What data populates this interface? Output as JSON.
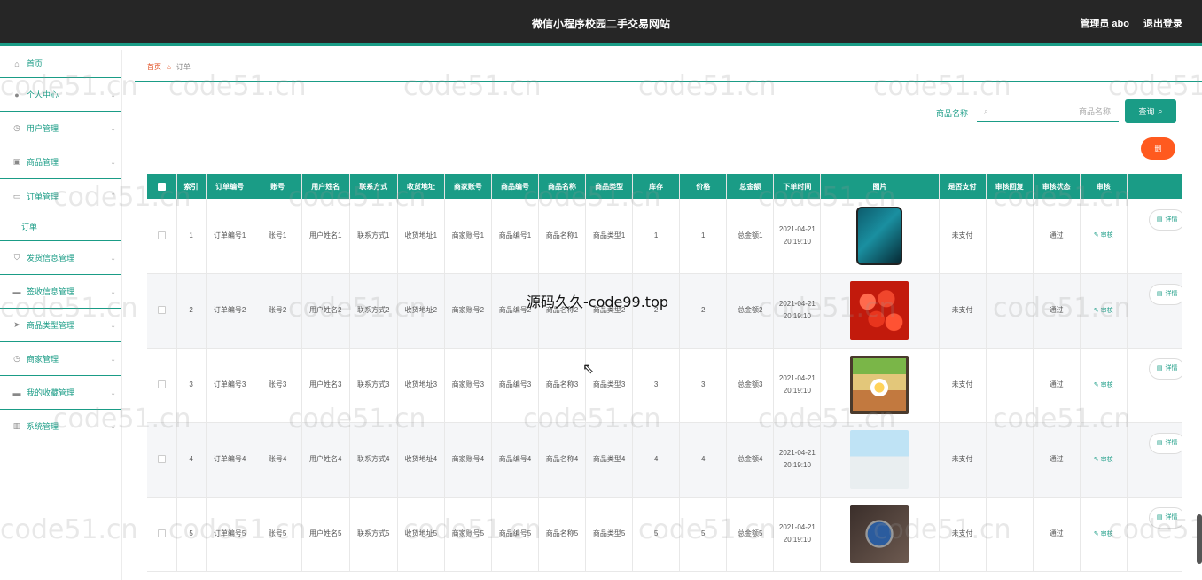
{
  "header": {
    "title": "微信小程序校园二手交易网站",
    "admin_label": "管理员 abo",
    "logout_label": "退出登录"
  },
  "sidebar": {
    "home": "首页",
    "items": [
      {
        "label": "个人中心",
        "icon": "user-icon"
      },
      {
        "label": "用户管理",
        "icon": "clock-icon"
      },
      {
        "label": "商品管理",
        "icon": "bag-icon"
      },
      {
        "label": "订单管理",
        "icon": "message-icon"
      }
    ],
    "sub_item": "订单",
    "items2": [
      {
        "label": "发货信息管理",
        "icon": "shield-icon"
      },
      {
        "label": "签收信息管理",
        "icon": "message-icon"
      },
      {
        "label": "商品类型管理",
        "icon": "send-icon"
      },
      {
        "label": "商家管理",
        "icon": "clock-icon"
      },
      {
        "label": "我的收藏管理",
        "icon": "message-icon"
      },
      {
        "label": "系统管理",
        "icon": "chart-icon"
      }
    ]
  },
  "breadcrumb": {
    "home": "首页",
    "current": "订单"
  },
  "search": {
    "label": "商品名称",
    "placeholder": "商品名称",
    "button": "查询"
  },
  "delete_button": "删",
  "table": {
    "headers": [
      "索引",
      "订单编号",
      "账号",
      "用户姓名",
      "联系方式",
      "收货地址",
      "商家账号",
      "商品编号",
      "商品名称",
      "商品类型",
      "库存",
      "价格",
      "总金额",
      "下单时间",
      "图片",
      "是否支付",
      "审核回复",
      "审核状态",
      "审核"
    ],
    "audit_label": "审核",
    "detail_label": "详情",
    "rows": [
      {
        "idx": "1",
        "order_no": "订单编号1",
        "account": "账号1",
        "name": "用户姓名1",
        "contact": "联系方式1",
        "address": "收货地址1",
        "merchant": "商家账号1",
        "goods_no": "商品编号1",
        "goods_name": "商品名称1",
        "goods_type": "商品类型1",
        "stock": "1",
        "price": "1",
        "total": "总金额1",
        "time": "2021-04-21 20:19:10",
        "image": "phone",
        "paid": "未支付",
        "reply": "",
        "status": "通过"
      },
      {
        "idx": "2",
        "order_no": "订单编号2",
        "account": "账号2",
        "name": "用户姓名2",
        "contact": "联系方式2",
        "address": "收货地址2",
        "merchant": "商家账号2",
        "goods_no": "商品编号2",
        "goods_name": "商品名称2",
        "goods_type": "商品类型2",
        "stock": "2",
        "price": "2",
        "total": "总金额2",
        "time": "2021-04-21 20:19:10",
        "image": "cherries",
        "paid": "未支付",
        "reply": "",
        "status": "通过"
      },
      {
        "idx": "3",
        "order_no": "订单编号3",
        "account": "账号3",
        "name": "用户姓名3",
        "contact": "联系方式3",
        "address": "收货地址3",
        "merchant": "商家账号3",
        "goods_no": "商品编号3",
        "goods_name": "商品名称3",
        "goods_type": "商品类型3",
        "stock": "3",
        "price": "3",
        "total": "总金额3",
        "time": "2021-04-21 20:19:10",
        "image": "lunchbox",
        "paid": "未支付",
        "reply": "",
        "status": "通过"
      },
      {
        "idx": "4",
        "order_no": "订单编号4",
        "account": "账号4",
        "name": "用户姓名4",
        "contact": "联系方式4",
        "address": "收货地址4",
        "merchant": "商家账号4",
        "goods_no": "商品编号4",
        "goods_name": "商品名称4",
        "goods_type": "商品类型4",
        "stock": "4",
        "price": "4",
        "total": "总金额4",
        "time": "2021-04-21 20:19:10",
        "image": "dress",
        "paid": "未支付",
        "reply": "",
        "status": "通过"
      },
      {
        "idx": "5",
        "order_no": "订单编号5",
        "account": "账号5",
        "name": "用户姓名5",
        "contact": "联系方式5",
        "address": "收货地址5",
        "merchant": "商家账号5",
        "goods_no": "商品编号5",
        "goods_name": "商品名称5",
        "goods_type": "商品类型5",
        "stock": "5",
        "price": "5",
        "total": "总金额5",
        "time": "2021-04-21 20:19:10",
        "image": "watch",
        "paid": "未支付",
        "reply": "",
        "status": "通过"
      }
    ]
  },
  "watermarks": {
    "site": "code51.cn",
    "center": "源码久久-code99.top"
  },
  "colors": {
    "accent": "#1a9c86",
    "header_bg": "#262626",
    "danger": "#ff5a1f"
  }
}
